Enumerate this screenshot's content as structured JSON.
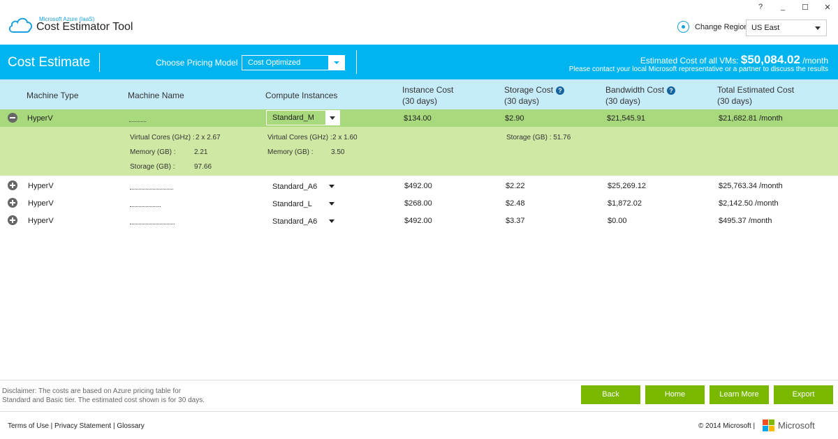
{
  "app": {
    "subtitle": "Microsoft Azure (IaaS)",
    "title": "Cost Estimator Tool",
    "window_controls": [
      "?",
      "_",
      "☐",
      "✕"
    ],
    "region_label": "Change Region",
    "region_value": "US East"
  },
  "header": {
    "title": "Cost Estimate",
    "pricing_label": "Choose Pricing Model",
    "pricing_value": "Cost Optimized",
    "total_label": "Estimated Cost of all VMs:",
    "total_amount": "$50,084.02",
    "total_suffix": "/month",
    "contact": "Please contact your local Microsoft representative or a partner to discuss the results"
  },
  "table": {
    "columns": {
      "machine_type": "Machine Type",
      "machine_name": "Machine Name",
      "compute": "Compute Instances",
      "instance_cost": "Instance Cost",
      "storage_cost": "Storage Cost",
      "bandwidth_cost": "Bandwidth Cost",
      "total_cost": "Total Estimated Cost",
      "period": "(30 days)"
    },
    "help_icon": "?",
    "expanded": {
      "type": "HyperV",
      "instance": "Standard_M",
      "instance_cost": "$134.00",
      "storage_cost": "$2.90",
      "bandwidth_cost": "$21,545.91",
      "total": "$21,682.81 /month",
      "source": {
        "cores_label": "Virtual Cores (GHz) :",
        "cores_value": "2 x 2.67",
        "memory_label": "Memory (GB) :",
        "memory_value": "2.21",
        "storage_label": "Storage (GB) :",
        "storage_value": "97.66"
      },
      "target": {
        "cores_label": "Virtual Cores (GHz) :",
        "cores_value": "2 x 1.60",
        "memory_label": "Memory (GB) :",
        "memory_value": "3.50"
      },
      "storage_detail": "Storage (GB) : 51.76"
    },
    "rows": [
      {
        "type": "HyperV",
        "instance": "Standard_A6",
        "instance_cost": "$492.00",
        "storage_cost": "$2.22",
        "bandwidth_cost": "$25,269.12",
        "total": "$25,763.34 /month"
      },
      {
        "type": "HyperV",
        "instance": "Standard_L",
        "instance_cost": "$268.00",
        "storage_cost": "$2.48",
        "bandwidth_cost": "$1,872.02",
        "total": "$2,142.50 /month"
      },
      {
        "type": "HyperV",
        "instance": "Standard_A6",
        "instance_cost": "$492.00",
        "storage_cost": "$3.37",
        "bandwidth_cost": "$0.00",
        "total": "$495.37 /month"
      }
    ]
  },
  "footer": {
    "disclaimer_line1": "Disclaimer: The costs are based on Azure pricing table for",
    "disclaimer_line2": "Standard and Basic tier. The estimated cost shown is for 30 days.",
    "buttons": {
      "back": "Back",
      "home": "Home",
      "learn_more": "Learn More",
      "export": "Export"
    },
    "links": "Terms of Use | Privacy Statement | Glossary",
    "copyright": "© 2014 Microsoft |",
    "brand": "Microsoft"
  },
  "colors": {
    "accent_blue": "#00b4f0",
    "header_light": "#c6ecfa",
    "row_green": "#a8d97c",
    "detail_green": "#cfe9a4",
    "button_green": "#7ab800"
  },
  "icons": [
    "cloud-icon",
    "location-pin-icon",
    "help-icon",
    "collapse-icon",
    "expand-icon",
    "chevron-down-icon",
    "microsoft-logo-icon"
  ]
}
